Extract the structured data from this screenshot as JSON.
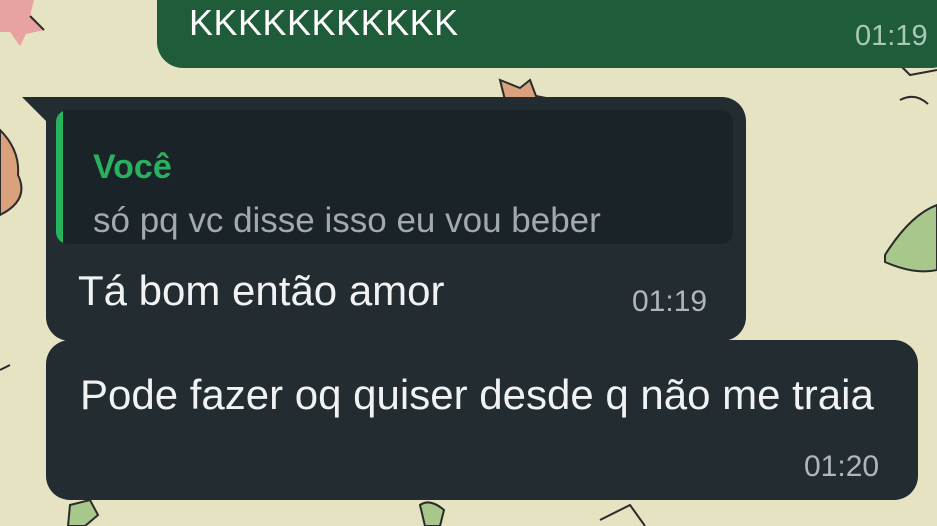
{
  "messages": [
    {
      "direction": "outgoing",
      "text": "KKKKKKKKKKK",
      "time": "01:19"
    },
    {
      "direction": "incoming",
      "reply_to": {
        "author": "Você",
        "text": "só pq vc disse isso eu vou beber"
      },
      "text": "Tá bom então amor",
      "time": "01:19"
    },
    {
      "direction": "incoming",
      "text": "Pode fazer oq quiser desde q não me traia",
      "time": "01:20"
    }
  ],
  "colors": {
    "wallpaper": "#e6e3c3",
    "outgoing_bubble": "#1f5c3a",
    "incoming_bubble": "#222c31",
    "quote_accent": "#27b35e"
  }
}
